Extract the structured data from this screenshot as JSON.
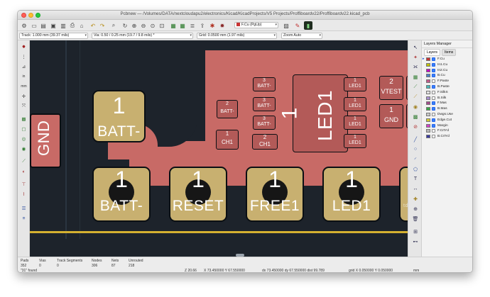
{
  "window": {
    "title": "Pcbnew — /Volumes/DATA/nextcloudapu2/electronics/Kicad/KicadProjects/V5 Projects/Proffiboardv22/Proffiboardv22.kicad_pcb"
  },
  "toolbar": {
    "layer_select": "F.Cu (PgUp)",
    "track": "Track: 1.000 mm (39.37 mils)",
    "via": "Via: 0.50 / 0.25 mm (19.7 / 9.8 mils) *",
    "grid": "Grid: 0.0500 mm (1.97 mils)",
    "zoom": "Zoom Auto"
  },
  "pcb": {
    "gnd_label": "GND",
    "big_pads": [
      {
        "num": "1",
        "label": "BATT-"
      },
      {
        "num": "1",
        "label": "BATT-"
      },
      {
        "num": "1",
        "label": "RESET"
      },
      {
        "num": "1",
        "label": "FREE1"
      },
      {
        "num": "1",
        "label": "LED1"
      },
      {
        "num": "",
        "label": "td-ne"
      }
    ],
    "smd_pads": [
      {
        "num": "3",
        "label": "BATT-"
      },
      {
        "num": "3",
        "label": "BATT-"
      },
      {
        "num": "3",
        "label": "BATT-"
      },
      {
        "num": "2",
        "label": "BATT-"
      },
      {
        "num": "1",
        "label": "CH1"
      },
      {
        "num": "2",
        "label": "CH1"
      },
      {
        "num": "1",
        "label": "LED1"
      },
      {
        "num": "1",
        "label": "LED1"
      },
      {
        "num": "1",
        "label": "LED1"
      },
      {
        "num": "1",
        "label": "LED1"
      },
      {
        "num": "2",
        "label": "VTEST"
      },
      {
        "num": "1",
        "label": "GND"
      },
      {
        "num": "",
        "label": "V"
      },
      {
        "num": "",
        "label": "V"
      }
    ],
    "led_big": {
      "num": "1",
      "label": "LED1"
    }
  },
  "layers_manager": {
    "title": "Layers Manager",
    "tabs": [
      "Layers",
      "Items"
    ],
    "layers": [
      {
        "name": "F.Cu",
        "color": "#c83434",
        "checked": true,
        "active": true
      },
      {
        "name": "In1.Cu",
        "color": "#c2c200",
        "checked": true
      },
      {
        "name": "In2.Cu",
        "color": "#c200c2",
        "checked": true
      },
      {
        "name": "B.Cu",
        "color": "#4d7fc4",
        "checked": true
      },
      {
        "name": "F.Paste",
        "color": "#c25a8a",
        "checked": false
      },
      {
        "name": "B.Paste",
        "color": "#48b8b8",
        "checked": true
      },
      {
        "name": "F.SilkS",
        "color": "#e0e0e0",
        "checked": false
      },
      {
        "name": "B.Silk",
        "color": "#a890d0",
        "checked": false
      },
      {
        "name": "F.Mas",
        "color": "#a44c8c",
        "checked": true
      },
      {
        "name": "B.Mas",
        "color": "#38a848",
        "checked": true
      },
      {
        "name": "Dwgs.Use",
        "color": "#c8c8c8",
        "checked": false
      },
      {
        "name": "Edge.Cut",
        "color": "#d4cc30",
        "checked": true
      },
      {
        "name": "Margin",
        "color": "#d040c8",
        "checked": true
      },
      {
        "name": "F.CrtYd",
        "color": "#b8b8b8",
        "checked": false
      },
      {
        "name": "B.CrtYd",
        "color": "#3a3aa0",
        "checked": false
      }
    ]
  },
  "status": {
    "pads_label": "Pads",
    "pads": "352",
    "vias_label": "Vias",
    "vias": "0",
    "track_label": "Track Segments",
    "track": "0",
    "nodes_label": "Nodes",
    "nodes": "306",
    "nets_label": "Nets",
    "nets": "87",
    "unrouted_label": "Unrouted",
    "unrouted": "218",
    "found": "\"31\" found",
    "zoom": "Z 20.66",
    "xy": "X 73.450000  Y 67.550000",
    "dxy": "dx 73.450000  dy 67.550000  dist 99.789",
    "grid": "grid X 0.050000  Y 0.050000",
    "units": "mm"
  }
}
